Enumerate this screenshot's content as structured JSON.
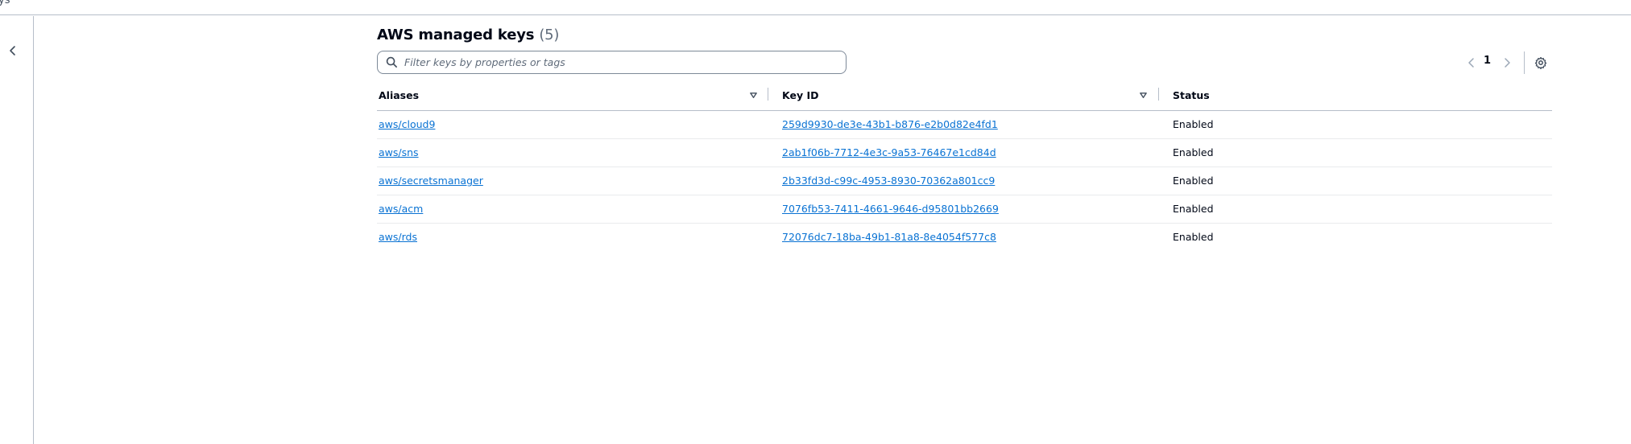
{
  "topbar": {
    "text": "ys"
  },
  "section": {
    "title": "AWS managed keys",
    "count": "(5)"
  },
  "search": {
    "placeholder": "Filter keys by properties or tags",
    "value": ""
  },
  "pagination": {
    "current_page": "1"
  },
  "icons": {
    "collapse": "chevron-left-icon",
    "search": "search-icon",
    "prev": "chevron-left-icon",
    "next": "chevron-right-icon",
    "settings": "gear-icon",
    "sort": "caret-down-icon"
  },
  "colors": {
    "link": "#0972d3",
    "text": "#000716",
    "border": "#b6bec9"
  },
  "table": {
    "columns": [
      "Aliases",
      "Key ID",
      "Status"
    ],
    "rows": [
      {
        "alias": "aws/cloud9",
        "key_id": "259d9930-de3e-43b1-b876-e2b0d82e4fd1",
        "status": "Enabled"
      },
      {
        "alias": "aws/sns",
        "key_id": "2ab1f06b-7712-4e3c-9a53-76467e1cd84d",
        "status": "Enabled"
      },
      {
        "alias": "aws/secretsmanager",
        "key_id": "2b33fd3d-c99c-4953-8930-70362a801cc9",
        "status": "Enabled"
      },
      {
        "alias": "aws/acm",
        "key_id": "7076fb53-7411-4661-9646-d95801bb2669",
        "status": "Enabled"
      },
      {
        "alias": "aws/rds",
        "key_id": "72076dc7-18ba-49b1-81a8-8e4054f577c8",
        "status": "Enabled"
      }
    ]
  }
}
